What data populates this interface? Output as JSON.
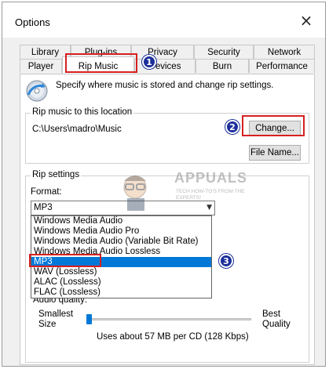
{
  "window": {
    "title": "Options",
    "close_glyph": "×"
  },
  "tabs_back": [
    "Library",
    "Plug-ins",
    "Privacy",
    "Security",
    "Network"
  ],
  "tabs_front": [
    "Player",
    "Rip Music",
    "Devices",
    "Burn",
    "Performance"
  ],
  "active_tab": "Rip Music",
  "header_text": "Specify where music is stored and change rip settings.",
  "location": {
    "group_label": "Rip music to this location",
    "path": "C:\\Users\\madro\\Music",
    "change_button": "Change...",
    "file_name_button": "File Name..."
  },
  "rip_settings": {
    "group_label": "Rip settings",
    "format_label": "Format:",
    "format_value": "MP3",
    "format_options": [
      "Windows Media Audio",
      "Windows Media Audio Pro",
      "Windows Media Audio (Variable Bit Rate)",
      "Windows Media Audio Lossless",
      "MP3",
      "WAV (Lossless)",
      "ALAC (Lossless)",
      "FLAC (Lossless)"
    ],
    "selected_option_index": 4,
    "audio_quality_label": "Audio quality:",
    "smallest_size_label": "Smallest\nSize",
    "best_quality_label": "Best\nQuality",
    "quality_level": 0,
    "usage_text": "Uses about 57 MB per CD (128 Kbps)"
  },
  "annotations": {
    "step1": "1",
    "step2": "2",
    "step3": "3"
  },
  "watermark": {
    "brand": "APPUALS",
    "tagline": "TECH HOW-TO'S FROM THE EXPERTS!"
  },
  "colors": {
    "highlight_red": "#d62020",
    "badge_blue": "#1c2f9b",
    "selection_blue": "#0078d7"
  },
  "icons": {
    "rip": "cd-rip-icon",
    "close": "close-icon",
    "dropdown": "chevron-down-icon"
  }
}
